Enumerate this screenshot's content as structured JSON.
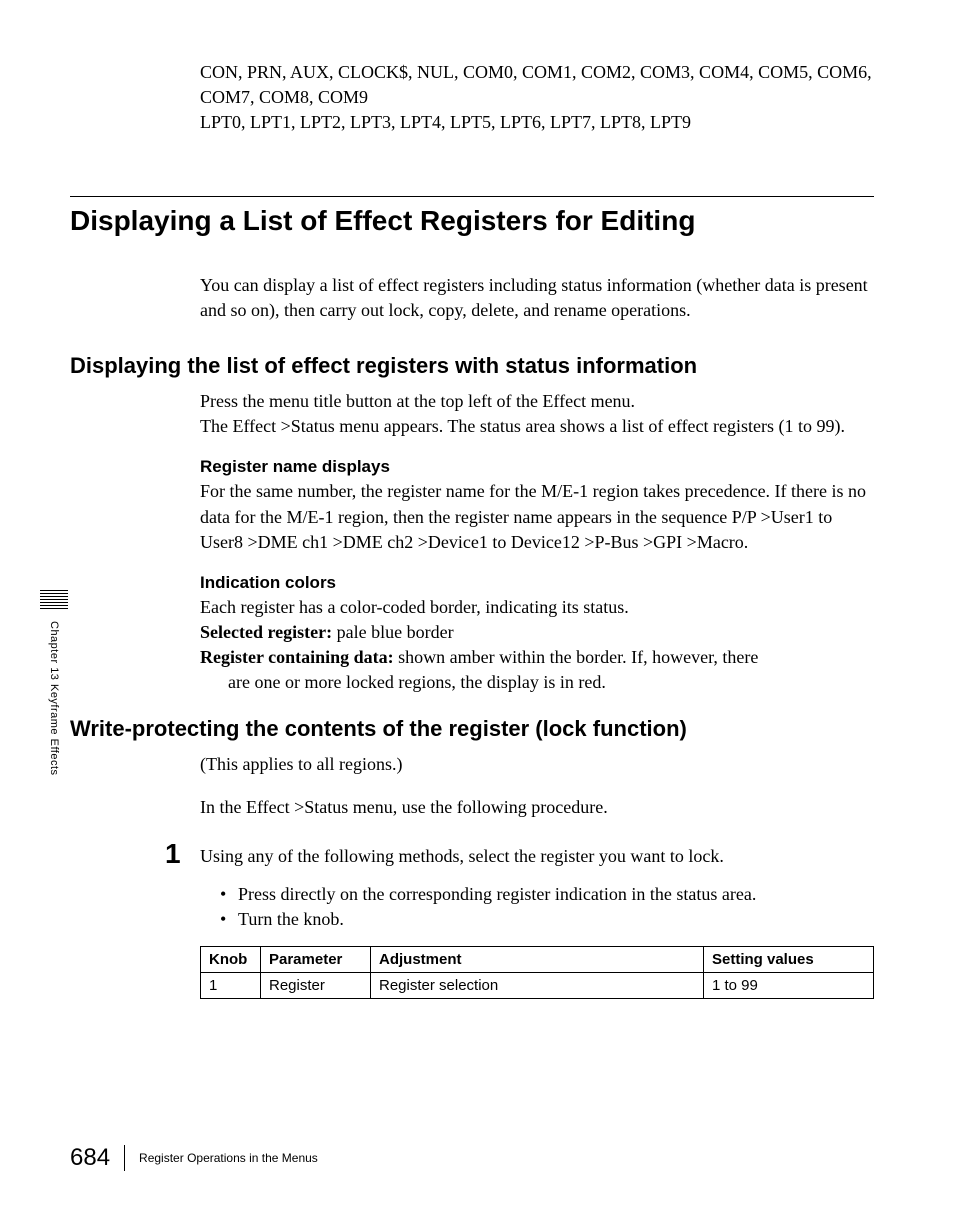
{
  "top_para": {
    "line1": "CON, PRN, AUX, CLOCK$, NUL, COM0, COM1, COM2, COM3, COM4, COM5, COM6, COM7, COM8, COM9",
    "line2": "LPT0, LPT1, LPT2, LPT3, LPT4, LPT5, LPT6, LPT7, LPT8, LPT9"
  },
  "h1": "Displaying a List of Effect Registers for Editing",
  "intro": "You can display a list of effect registers including status information (whether data is present and so on), then carry out lock, copy, delete, and rename operations.",
  "section1": {
    "heading": "Displaying the list of effect registers with status information",
    "para": "Press the menu title button at the top left of the Effect menu.\nThe Effect >Status menu appears. The status area shows a list of effect registers (1 to 99).",
    "sub1_heading": "Register name displays",
    "sub1_para": "For the same number, the register name for the M/E-1 region takes precedence. If there is no data for the M/E-1 region, then the register name appears in the sequence P/P >User1 to User8 >DME ch1 >DME ch2 >Device1 to Device12 >P-Bus >GPI >Macro.",
    "sub2_heading": "Indication colors",
    "sub2_intro": "Each register has a color-coded border, indicating its status.",
    "defs": [
      {
        "term": "Selected register:",
        "desc": " pale blue border"
      },
      {
        "term": "Register containing data:",
        "desc": " shown amber within the border. If, however, there",
        "cont": "are one or more locked regions, the display is in red."
      }
    ]
  },
  "section2": {
    "heading": "Write-protecting the contents of the register (lock function)",
    "para1": "(This applies to all regions.)",
    "para2": "In the Effect >Status menu, use the following procedure.",
    "step_num": "1",
    "step_text": "Using any of the following methods, select the register you want to lock.",
    "bullets": [
      "Press directly on the corresponding register indication in the status area.",
      "Turn the knob."
    ],
    "table": {
      "headers": [
        "Knob",
        "Parameter",
        "Adjustment",
        "Setting values"
      ],
      "row": [
        "1",
        "Register",
        "Register selection",
        "1 to 99"
      ]
    }
  },
  "sidebar": "Chapter 13   Keyframe Effects",
  "footer": {
    "page": "684",
    "text": "Register Operations in the Menus"
  }
}
